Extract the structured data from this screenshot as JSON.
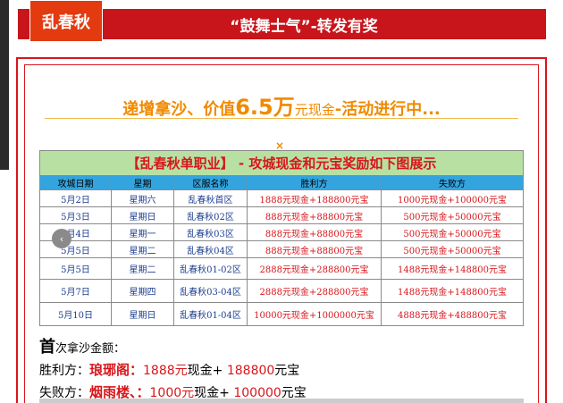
{
  "header": {
    "brand": "乱春秋",
    "title": "“鼓舞士气”-转发有奖"
  },
  "promo": {
    "part1": "递增拿沙、价值",
    "amount": "6.5万",
    "part2": "元现金",
    "part3": "-活动进行中...",
    "x_mark": "×"
  },
  "table": {
    "title": "【乱春秋单职业】 - 攻城现金和元宝奖励如下图展示",
    "headers": [
      "攻城日期",
      "星期",
      "区服名称",
      "胜利方",
      "失败方"
    ],
    "rows": [
      [
        "5月2日",
        "星期六",
        "乱春秋首区",
        "1888元现金+188800元宝",
        "1000元现金+100000元宝"
      ],
      [
        "5月3日",
        "星期日",
        "乱春秋02区",
        "888元现金+88800元宝",
        "500元现金+50000元宝"
      ],
      [
        "5月4日",
        "星期一",
        "乱春秋03区",
        "888元现金+88800元宝",
        "500元现金+50000元宝"
      ],
      [
        "5月5日",
        "星期二",
        "乱春秋04区",
        "888元现金+88800元宝",
        "500元现金+50000元宝"
      ],
      [
        "5月5日",
        "星期二",
        "乱春秋01-02区",
        "2888元现金+288800元宝",
        "1488元现金+148800元宝"
      ],
      [
        "5月7日",
        "星期四",
        "乱春秋03-04区",
        "2888元现金+288800元宝",
        "1488元现金+148800元宝"
      ],
      [
        "5月10日",
        "星期日",
        "乱春秋01-04区",
        "10000元现金+1000000元宝",
        "4888元现金+488800元宝"
      ]
    ]
  },
  "nav": {
    "icon": "‹"
  },
  "section": {
    "first_char": "首",
    "rest": "次拿沙金额："
  },
  "winner": {
    "role": "胜利方：",
    "name": "琅琊阁：",
    "cash": "1888元",
    "cash_unit": "现金",
    "plus": "+ ",
    "ingot": "188800",
    "ingot_unit": "元宝"
  },
  "loser": {
    "role": "失败方：",
    "name": "烟雨楼、：",
    "cash": "1000元",
    "cash_unit": "现金",
    "plus": "+ ",
    "ingot": "100000",
    "ingot_unit": "元宝"
  }
}
